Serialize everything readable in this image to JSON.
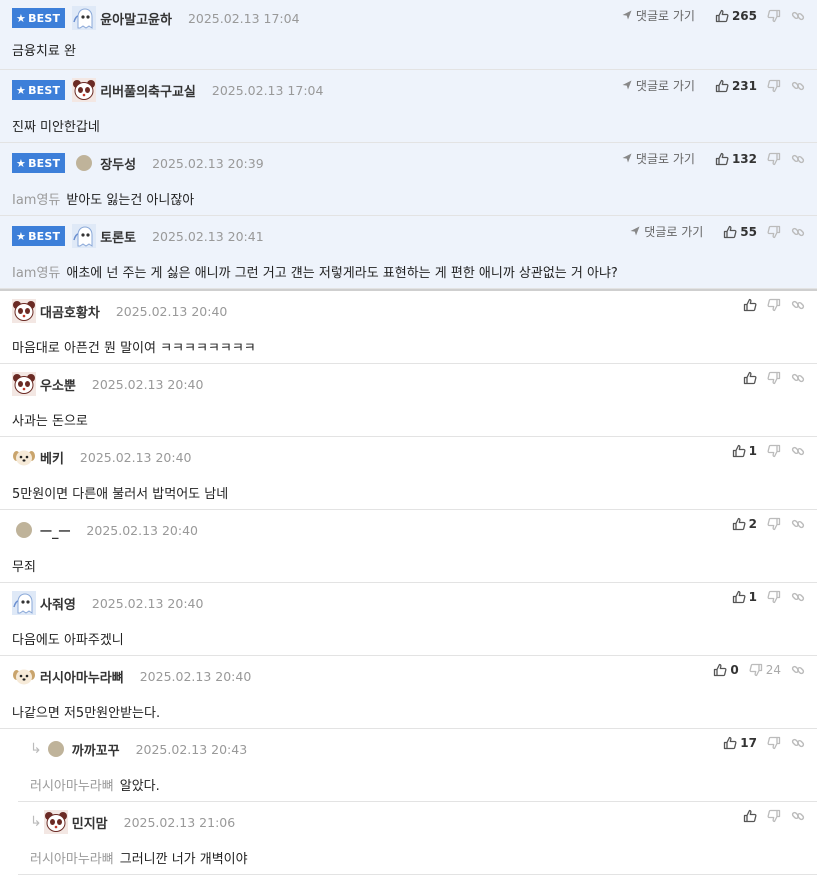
{
  "best_label": "BEST",
  "goto_label": "댓글로 가기",
  "best_comments": [
    {
      "avatar": "ghost",
      "nick": "윤아말고윤하",
      "date": "2025.02.13 17:04",
      "mention": "",
      "text": "금융치료 완",
      "likes": "265"
    },
    {
      "avatar": "panda",
      "nick": "리버풀의축구교실",
      "date": "2025.02.13 17:04",
      "mention": "",
      "text": "진짜 미안한갑네",
      "likes": "231"
    },
    {
      "avatar": "dot",
      "nick": "장두성",
      "date": "2025.02.13 20:39",
      "mention": "Iam영듀",
      "text": "받아도 잃는건 아니잖아",
      "likes": "132"
    },
    {
      "avatar": "ghost",
      "nick": "토론토",
      "date": "2025.02.13 20:41",
      "mention": "Iam영듀",
      "text": "애초에 넌 주는 게 싫은 애니까 그런 거고 걘는 저렇게라도 표현하는 게 편한 애니까 상관없는 거 아냐?",
      "likes": "55"
    }
  ],
  "comments": [
    {
      "avatar": "panda",
      "nick": "대곰호황차",
      "date": "2025.02.13 20:40",
      "mention": "",
      "text": "마음대로 아픈건 뭔 말이여 ㅋㅋㅋㅋㅋㅋㅋㅋ",
      "likes": "",
      "dislikes": ""
    },
    {
      "avatar": "panda",
      "nick": "우소뿐",
      "date": "2025.02.13 20:40",
      "mention": "",
      "text": "사과는 돈으로",
      "likes": "",
      "dislikes": ""
    },
    {
      "avatar": "puppy",
      "nick": "베키",
      "date": "2025.02.13 20:40",
      "mention": "",
      "text": "5만원이면 다른애 불러서 밥먹어도 남네",
      "likes": "1",
      "dislikes": ""
    },
    {
      "avatar": "dot",
      "nick": "ㅡ_ㅡ",
      "date": "2025.02.13 20:40",
      "mention": "",
      "text": "무죄",
      "likes": "2",
      "dislikes": ""
    },
    {
      "avatar": "ghost",
      "nick": "사줘영",
      "date": "2025.02.13 20:40",
      "mention": "",
      "text": "다음에도 아파주겠니",
      "likes": "1",
      "dislikes": ""
    },
    {
      "avatar": "puppy",
      "nick": "러시아마누라뼈",
      "date": "2025.02.13 20:40",
      "mention": "",
      "text": "나같으면 저5만원안받는다.",
      "likes": "0",
      "dislikes": "24"
    }
  ],
  "replies": [
    {
      "avatar": "dot",
      "nick": "까까꼬꾸",
      "date": "2025.02.13 20:43",
      "mention": "러시아마누라뼈",
      "text": "알았다.",
      "likes": "17",
      "dislikes": ""
    },
    {
      "avatar": "panda",
      "nick": "민지맘",
      "date": "2025.02.13 21:06",
      "mention": "러시아마누라뼈",
      "text": "그러니깐 너가 개벽이야",
      "likes": "",
      "dislikes": ""
    }
  ]
}
